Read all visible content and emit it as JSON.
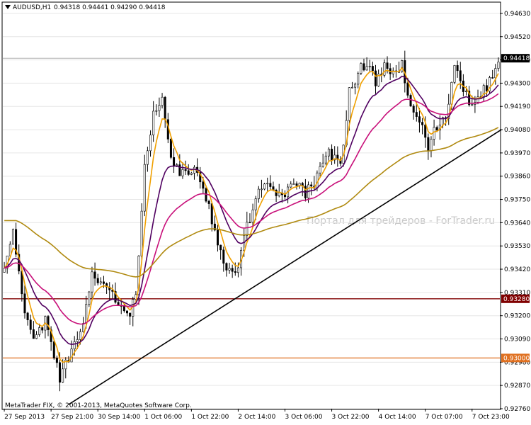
{
  "header": {
    "symbol": "AUDUSD,H1",
    "ohlc": "0.94318 0.94441 0.94290 0.94418"
  },
  "watermark": "Портал для трейдеров - ForTrader.ru",
  "copyright": "MetaTrader FIX, © 2001-2013, MetaQuotes Software Corp.",
  "colors": {
    "candles": "#000000",
    "ma_fast": "#f0a000",
    "ma_medium": "#500060",
    "ma_slow": "#c8107a",
    "ma_long": "#b08a10",
    "resistance_line": "#800000",
    "support_line": "#e07020",
    "trendline": "#000000",
    "price_tag": "#000000"
  },
  "chart_data": {
    "type": "candlestick",
    "symbol": "AUDUSD",
    "timeframe": "H1",
    "y_axis": {
      "range": [
        0.9276,
        0.9468
      ],
      "ticks": [
        "0.94630",
        "0.94520",
        "0.94410",
        "0.94300",
        "0.94190",
        "0.94080",
        "0.93970",
        "0.93860",
        "0.93750",
        "0.93640",
        "0.93530",
        "0.93420",
        "0.93310",
        "0.93200",
        "0.93090",
        "0.92980",
        "0.92870",
        "0.92760"
      ]
    },
    "x_axis": {
      "labels": [
        "27 Sep 2013",
        "27 Sep 21:00",
        "30 Sep 14:00",
        "1 Oct 06:00",
        "1 Oct 22:00",
        "2 Oct 14:00",
        "3 Oct 06:00",
        "3 Oct 22:00",
        "4 Oct 14:00",
        "7 Oct 07:00",
        "7 Oct 23:00"
      ],
      "label_bar_index": [
        0,
        16,
        32,
        48,
        64,
        80,
        96,
        112,
        128,
        144,
        160
      ]
    },
    "bar_count": 170,
    "current_price": {
      "value": 0.94418,
      "label": "0.94418"
    },
    "horizontal_levels": [
      {
        "value": 0.9328,
        "label": "0.93280",
        "color": "#800000"
      },
      {
        "value": 0.93,
        "label": "0.93000",
        "color": "#e07020"
      }
    ],
    "trendline": [
      {
        "bar": 22,
        "price": 0.9278
      },
      {
        "bar": 170,
        "price": 0.9408
      }
    ],
    "anchors": [
      {
        "bar": 0,
        "price": 0.9343
      },
      {
        "bar": 3,
        "price": 0.9362
      },
      {
        "bar": 7,
        "price": 0.9322
      },
      {
        "bar": 10,
        "price": 0.931
      },
      {
        "bar": 14,
        "price": 0.9318
      },
      {
        "bar": 19,
        "price": 0.929
      },
      {
        "bar": 22,
        "price": 0.93
      },
      {
        "bar": 26,
        "price": 0.9312
      },
      {
        "bar": 30,
        "price": 0.9338
      },
      {
        "bar": 34,
        "price": 0.9338
      },
      {
        "bar": 38,
        "price": 0.9328
      },
      {
        "bar": 42,
        "price": 0.932
      },
      {
        "bar": 45,
        "price": 0.9328
      },
      {
        "bar": 48,
        "price": 0.939
      },
      {
        "bar": 51,
        "price": 0.9415
      },
      {
        "bar": 54,
        "price": 0.9425
      },
      {
        "bar": 57,
        "price": 0.9395
      },
      {
        "bar": 60,
        "price": 0.9386
      },
      {
        "bar": 64,
        "price": 0.939
      },
      {
        "bar": 67,
        "price": 0.9385
      },
      {
        "bar": 70,
        "price": 0.937
      },
      {
        "bar": 74,
        "price": 0.935
      },
      {
        "bar": 77,
        "price": 0.934
      },
      {
        "bar": 80,
        "price": 0.9342
      },
      {
        "bar": 83,
        "price": 0.9362
      },
      {
        "bar": 87,
        "price": 0.9378
      },
      {
        "bar": 91,
        "price": 0.9382
      },
      {
        "bar": 95,
        "price": 0.9376
      },
      {
        "bar": 99,
        "price": 0.9383
      },
      {
        "bar": 103,
        "price": 0.9378
      },
      {
        "bar": 107,
        "price": 0.9385
      },
      {
        "bar": 111,
        "price": 0.9398
      },
      {
        "bar": 115,
        "price": 0.9392
      },
      {
        "bar": 118,
        "price": 0.9425
      },
      {
        "bar": 121,
        "price": 0.9435
      },
      {
        "bar": 124,
        "price": 0.944
      },
      {
        "bar": 127,
        "price": 0.943
      },
      {
        "bar": 130,
        "price": 0.944
      },
      {
        "bar": 133,
        "price": 0.9435
      },
      {
        "bar": 136,
        "price": 0.9438
      },
      {
        "bar": 139,
        "price": 0.942
      },
      {
        "bar": 142,
        "price": 0.9412
      },
      {
        "bar": 145,
        "price": 0.94
      },
      {
        "bar": 148,
        "price": 0.941
      },
      {
        "bar": 151,
        "price": 0.9415
      },
      {
        "bar": 154,
        "price": 0.9438
      },
      {
        "bar": 157,
        "price": 0.9428
      },
      {
        "bar": 160,
        "price": 0.942
      },
      {
        "bar": 163,
        "price": 0.9425
      },
      {
        "bar": 166,
        "price": 0.943
      },
      {
        "bar": 169,
        "price": 0.9442
      }
    ]
  }
}
